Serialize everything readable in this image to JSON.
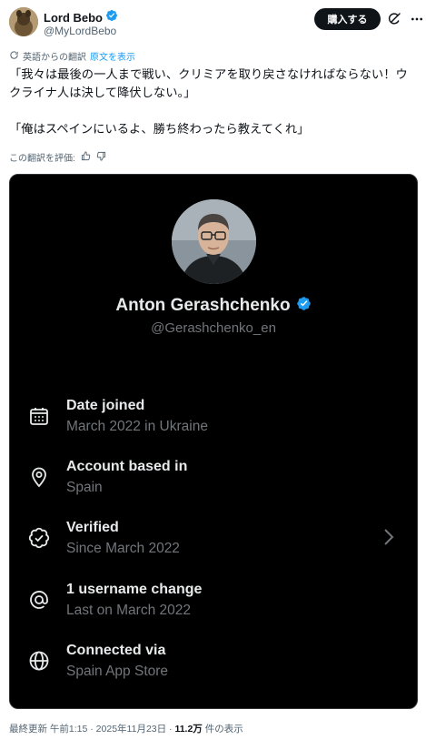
{
  "post": {
    "author_name": "Lord Bebo",
    "author_handle": "@MyLordBebo",
    "buy_button_label": "購入する",
    "translated_from": "英語からの翻訳",
    "show_original": "原文を表示",
    "text_line1": "「我々は最後の一人まで戦い、クリミアを取り戻さなければならない！ウクライナ人は決して降伏しない。」",
    "text_line2": "「俺はスペインにいるよ、勝ち終わったら教えてくれ」",
    "rate_translation": "この翻訳を評価:",
    "footer_time": "最終更新 午前1:15 · 2025年11月23日 · ",
    "footer_views_count": "11.2万",
    "footer_views_label": " 件の表示"
  },
  "profile_card": {
    "name": "Anton Gerashchenko",
    "handle": "@Gerashchenko_en",
    "rows": [
      {
        "title": "Date joined",
        "subtitle": "March 2022 in Ukraine",
        "icon": "calendar-icon"
      },
      {
        "title": "Account based in",
        "subtitle": "Spain",
        "icon": "location-pin-icon"
      },
      {
        "title": "Verified",
        "subtitle": "Since March 2022",
        "icon": "verified-badge-icon"
      },
      {
        "title": "1 username change",
        "subtitle": "Last on March 2022",
        "icon": "at-sign-icon"
      },
      {
        "title": "Connected via",
        "subtitle": "Spain App Store",
        "icon": "globe-icon"
      }
    ]
  },
  "colors": {
    "accent": "#1d9bf0",
    "card_bg": "#000000",
    "button_bg": "#0f1419"
  }
}
